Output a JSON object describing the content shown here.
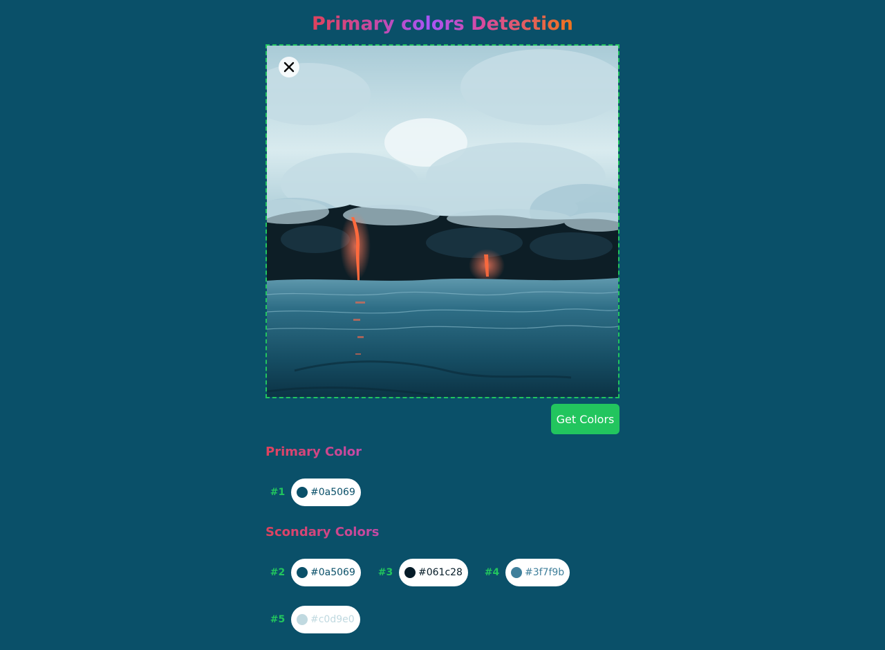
{
  "header": {
    "title": "Primary colors Detection"
  },
  "uploader": {
    "close_icon": "close-icon",
    "image_subject": "lava flowing into ocean under clouds"
  },
  "actions": {
    "get_colors_label": "Get Colors",
    "accent_color": "#22c55e"
  },
  "primary": {
    "heading": "Primary Color",
    "swatches": [
      {
        "label": "#1",
        "hex": "#0a5069",
        "color": "#0a5069",
        "text_color": "#0a5069"
      }
    ]
  },
  "secondary": {
    "heading": "Scondary Colors",
    "swatches": [
      {
        "label": "#2",
        "hex": "#0a5069",
        "color": "#0a5069",
        "text_color": "#0a5069"
      },
      {
        "label": "#3",
        "hex": "#061c28",
        "color": "#061c28",
        "text_color": "#061c28"
      },
      {
        "label": "#4",
        "hex": "#3f7f9b",
        "color": "#3f7f9b",
        "text_color": "#3f7f9b"
      },
      {
        "label": "#5",
        "hex": "#c0d9e0",
        "color": "#c0d9e0",
        "text_color": "#c0d9e0"
      }
    ]
  },
  "theme": {
    "background": "#0a5069",
    "dropzone_border": "#22c55e"
  }
}
